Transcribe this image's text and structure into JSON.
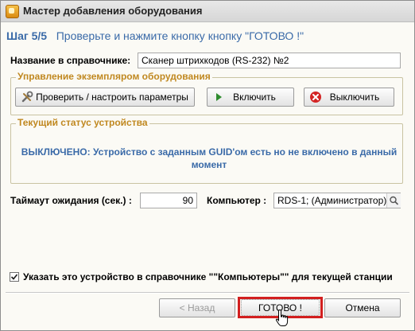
{
  "window": {
    "title": "Мастер добавления оборудования"
  },
  "heading": {
    "step": "Шаг 5/5",
    "text": "Проверьте и нажмите кнопку кнопку \"ГОТОВО !\""
  },
  "name_field": {
    "label": "Название в справочнике:",
    "value": "Сканер штрихкодов (RS-232) №2"
  },
  "management": {
    "title": "Управление экземпляром оборудования",
    "check_label": "Проверить / настроить параметры",
    "enable_label": "Включить",
    "disable_label": "Выключить"
  },
  "status": {
    "title": "Текущий статус устройства",
    "text": "ВЫКЛЮЧЕНО: Устройство с заданным GUID'ом есть но не включено в данный момент"
  },
  "timeout": {
    "label": "Таймаут ожидания (сек.) :",
    "value": "90"
  },
  "computer": {
    "label": "Компьютер :",
    "value": "RDS-1; (Администратор)"
  },
  "station_checkbox": {
    "label": "Указать это устройство в справочнике \"\"Компьютеры\"\" для текущей станции",
    "checked": true
  },
  "footer": {
    "back_label": "< Назад",
    "done_label": "ГОТОВО !",
    "cancel_label": "Отмена"
  },
  "colors": {
    "accent": "#3a6aa8",
    "group_title": "#c08820",
    "highlight": "#d21f1f"
  }
}
